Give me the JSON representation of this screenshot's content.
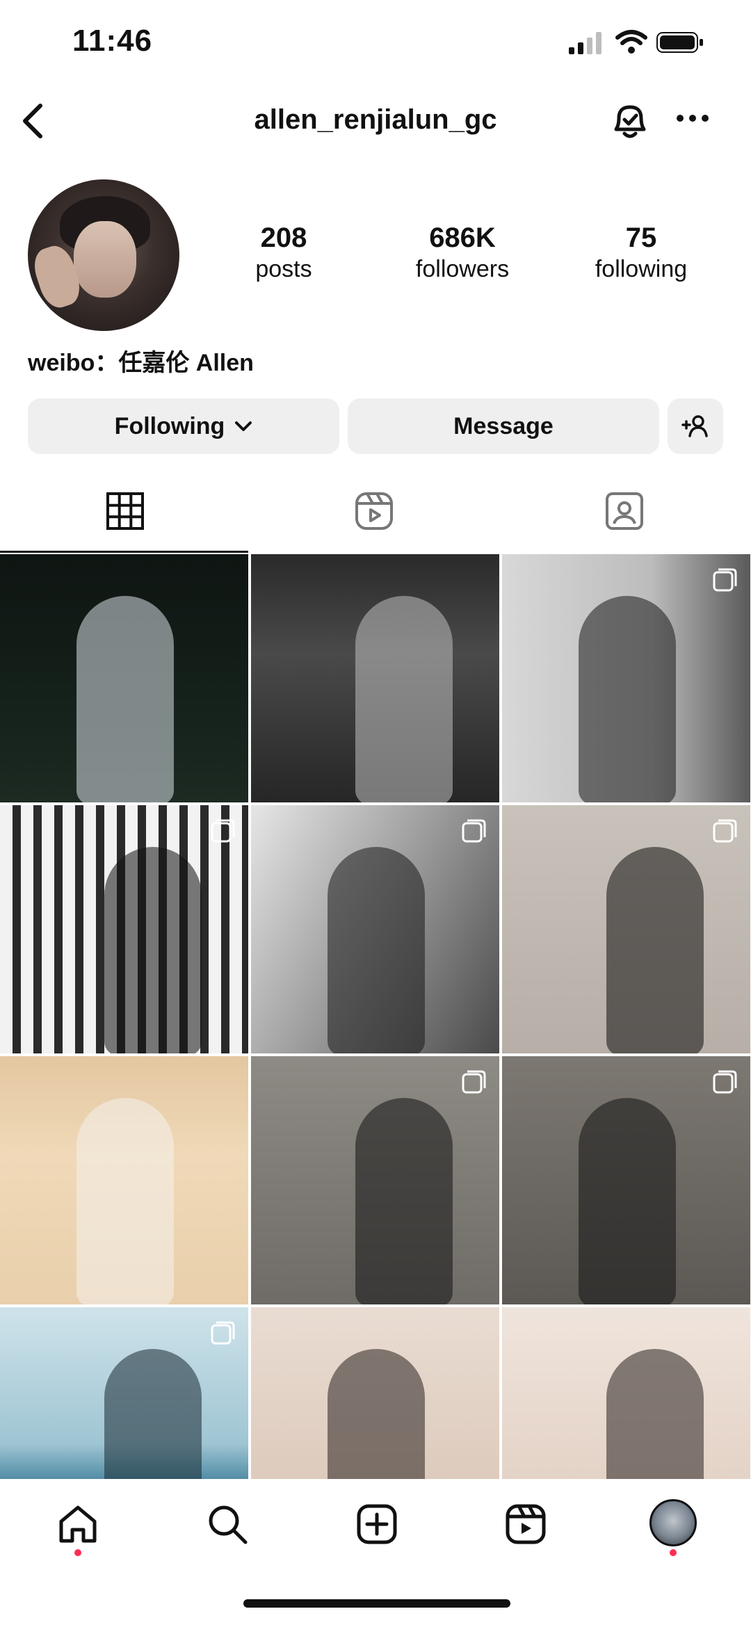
{
  "status_bar": {
    "time": "11:46"
  },
  "header": {
    "username": "allen_renjialun_gc"
  },
  "profile": {
    "stats": [
      {
        "number": "208",
        "label": "posts"
      },
      {
        "number": "686K",
        "label": "followers"
      },
      {
        "number": "75",
        "label": "following"
      }
    ],
    "bio": "weibo：任嘉伦 Allen"
  },
  "buttons": {
    "following": "Following",
    "message": "Message"
  },
  "grid": {
    "tiles": [
      {
        "bg": "linear-gradient(180deg,#0f1512 0%,#14201a 55%,#1c2a22 100%)",
        "multi": false,
        "accent": "#d9dfe6"
      },
      {
        "bg": "linear-gradient(180deg,#2a2a2a 0%,#4a4a4a 40%,#262626 100%)",
        "multi": false,
        "accent": "#bdbdbd"
      },
      {
        "bg": "linear-gradient(90deg,#d8d8d8 0%,#bcbcbc 60%,#5a5a5a 100%)",
        "multi": true,
        "accent": "#1a1a1a"
      },
      {
        "bg": "repeating-linear-gradient(90deg,#f2f2f2 0 18px,#2a2a2a 18px 30px)",
        "multi": true,
        "accent": "#111111"
      },
      {
        "bg": "linear-gradient(120deg,#e6e6e6 0%,#9a9a9a 50%,#4a4a4a 100%)",
        "multi": true,
        "accent": "#1a1a1a"
      },
      {
        "bg": "linear-gradient(180deg,#c9c2ba 0%,#b7afa7 100%)",
        "multi": true,
        "accent": "#111111"
      },
      {
        "bg": "linear-gradient(180deg,#e3c7a0 0%,#f0d9b8 40%,#e9cfab 100%)",
        "multi": false,
        "accent": "#f4f1ec"
      },
      {
        "bg": "linear-gradient(180deg,#8e8a84 0%,#6f6b66 100%)",
        "multi": true,
        "accent": "#141414"
      },
      {
        "bg": "linear-gradient(180deg,#7d7872 0%,#5c5853 100%)",
        "multi": true,
        "accent": "#141414"
      },
      {
        "bg": "linear-gradient(180deg,#cfe3ea 0%,#9fc5d3 55%,#4e8aa3 70%,#3a7590 100%)",
        "multi": true,
        "accent": "#1a2a33"
      },
      {
        "bg": "linear-gradient(180deg,#e9dcd2 0%,#d8c3b3 100%)",
        "multi": false,
        "accent": "#2a2220"
      },
      {
        "bg": "linear-gradient(180deg,#efe4dc 0%,#dfcbbd 100%)",
        "multi": false,
        "accent": "#2a2220"
      }
    ]
  }
}
